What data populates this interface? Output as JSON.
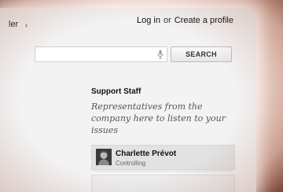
{
  "header": {
    "breadcrumb_tail": "ler",
    "breadcrumb_chevron": "›",
    "login_label": "Log in",
    "separator": "or",
    "create_profile_label": "Create a profile"
  },
  "search": {
    "value": "",
    "placeholder": "",
    "button_label": "SEARCH",
    "mic_icon": "microphone-icon"
  },
  "support": {
    "title": "Support Staff",
    "description": "Representatives from the company here to listen to your issues",
    "staff": [
      {
        "name": "Charlette Prévot",
        "department": "Controlling"
      }
    ]
  }
}
